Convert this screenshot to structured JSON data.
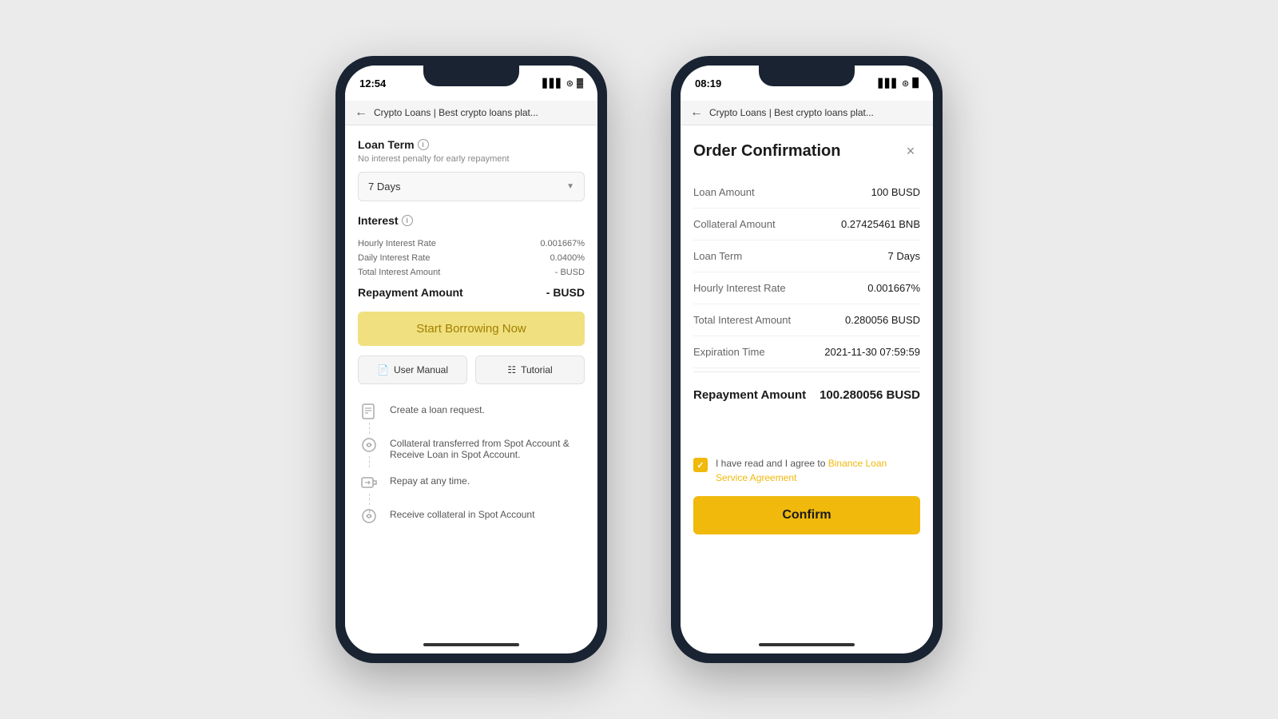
{
  "phone1": {
    "status_time": "12:54",
    "status_signal": "▋▋▋",
    "status_wifi": "WiFi",
    "status_battery": "⬜",
    "browser_url": "Crypto Loans | Best crypto loans plat...",
    "loan_term_label": "Loan Term",
    "loan_term_subtitle": "No interest penalty for early repayment",
    "loan_term_value": "7 Days",
    "interest_label": "Interest",
    "hourly_rate_label": "Hourly Interest Rate",
    "hourly_rate_value": "0.001667%",
    "daily_rate_label": "Daily Interest Rate",
    "daily_rate_value": "0.0400%",
    "total_interest_label": "Total Interest Amount",
    "total_interest_value": "- BUSD",
    "repayment_label": "Repayment Amount",
    "repayment_value": "- BUSD",
    "borrow_btn_label": "Start Borrowing Now",
    "user_manual_label": "User Manual",
    "tutorial_label": "Tutorial",
    "step1": "Create a loan request.",
    "step2": "Collateral transferred from Spot Account & Receive Loan in Spot Account.",
    "step3": "Repay at any time.",
    "step4": "Receive collateral in Spot Account"
  },
  "phone2": {
    "status_time": "08:19",
    "browser_url": "Crypto Loans | Best crypto loans plat...",
    "modal_title": "Order Confirmation",
    "loan_amount_label": "Loan Amount",
    "loan_amount_value": "100 BUSD",
    "collateral_label": "Collateral Amount",
    "collateral_value": "0.27425461 BNB",
    "loan_term_label": "Loan Term",
    "loan_term_value": "7 Days",
    "hourly_rate_label": "Hourly Interest Rate",
    "hourly_rate_value": "0.001667%",
    "total_interest_label": "Total Interest Amount",
    "total_interest_value": "0.280056 BUSD",
    "expiration_label": "Expiration Time",
    "expiration_value": "2021-11-30 07:59:59",
    "repayment_label": "Repayment Amount",
    "repayment_value": "100.280056 BUSD",
    "agreement_text": "I have read and I agree to ",
    "agreement_link": "Binance Loan Service Agreement",
    "confirm_label": "Confirm"
  }
}
